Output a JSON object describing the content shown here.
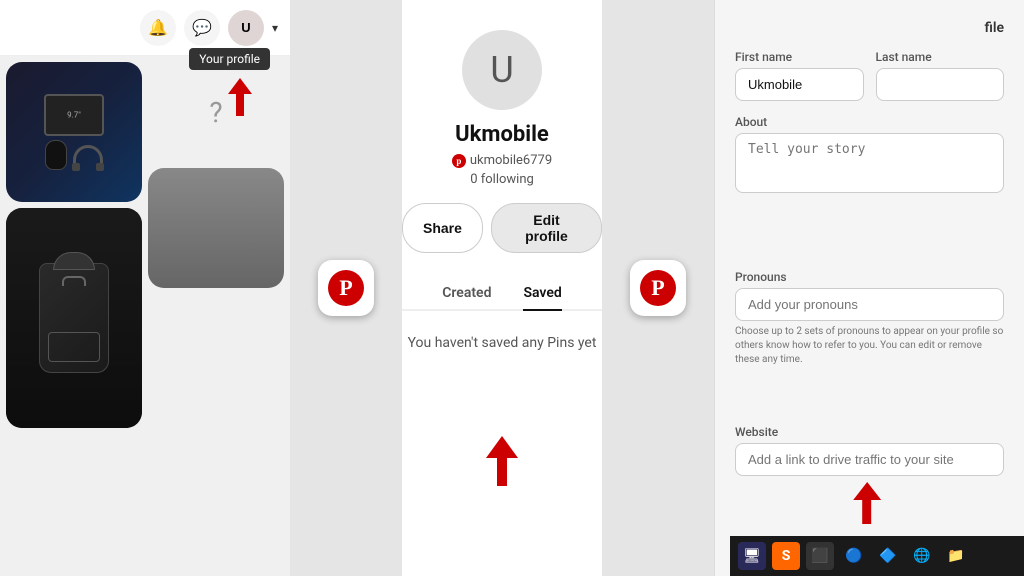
{
  "left_panel": {
    "nav": {
      "bell_icon": "🔔",
      "chat_icon": "💬",
      "user_initial": "U",
      "chevron": "▾"
    },
    "tooltip": "Your profile",
    "pins": {
      "question_mark": "?"
    }
  },
  "red_bars": {
    "pinterest_letter": "P"
  },
  "middle_panel": {
    "avatar_letter": "U",
    "username_display": "Ukmobile",
    "handle": "ukmobile6779",
    "following": "0 following",
    "share_label": "Share",
    "edit_label": "Edit profile",
    "tabs": [
      {
        "label": "Created",
        "active": false
      },
      {
        "label": "Saved",
        "active": true
      }
    ],
    "no_pins_text": "You haven't saved any Pins yet"
  },
  "right_panel": {
    "title": "file",
    "first_name_label": "First name",
    "last_name_label": "Last name",
    "first_name_value": "Ukmobile",
    "last_name_value": "",
    "about_label": "About",
    "about_placeholder": "Tell your story",
    "pronouns_label": "Pronouns",
    "pronouns_placeholder": "Add your pronouns",
    "pronouns_hint": "Choose up to 2 sets of pronouns to appear on your profile so others know how to refer to you. You can edit or remove these any time.",
    "website_label": "Website",
    "website_placeholder": "Add a link to drive traffic to your site"
  },
  "taskbar": {
    "icons": [
      "🖥",
      "S",
      "⬛",
      "🔵",
      "🔷",
      "🌐",
      "📁"
    ]
  }
}
